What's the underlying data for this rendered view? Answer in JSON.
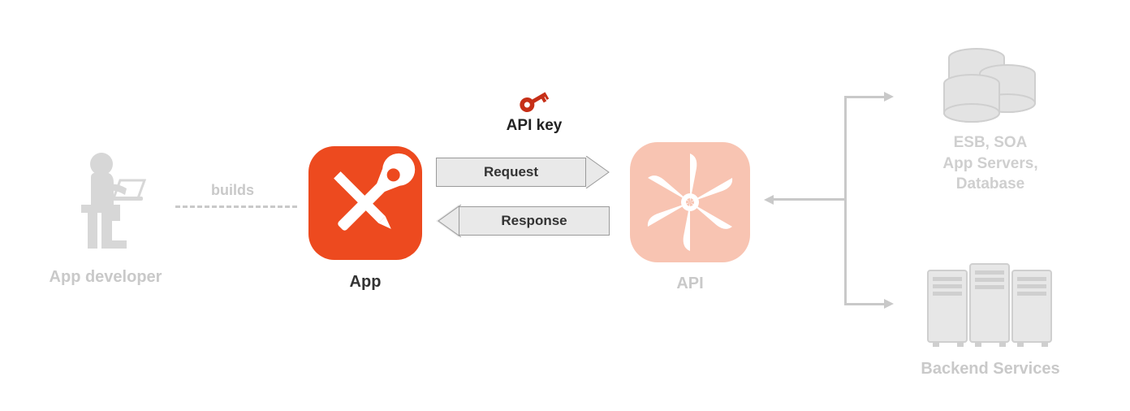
{
  "nodes": {
    "developer": {
      "label": "App developer"
    },
    "app": {
      "label": "App"
    },
    "api": {
      "label": "API"
    },
    "backend": {
      "label": "Backend Services",
      "desc_line1": "ESB, SOA",
      "desc_line2": "App Servers,",
      "desc_line3": "Database"
    }
  },
  "connectors": {
    "builds": {
      "label": "builds"
    },
    "request": {
      "label": "Request"
    },
    "response": {
      "label": "Response"
    },
    "apikey": {
      "label": "API key"
    }
  },
  "colors": {
    "accent": "#ED4A1F",
    "accent_light": "#F8C4B2",
    "faded": "#c9c9c9",
    "key": "#C62F17",
    "arrow_fill": "#e9e9e9",
    "arrow_border": "#9a9a9a"
  }
}
